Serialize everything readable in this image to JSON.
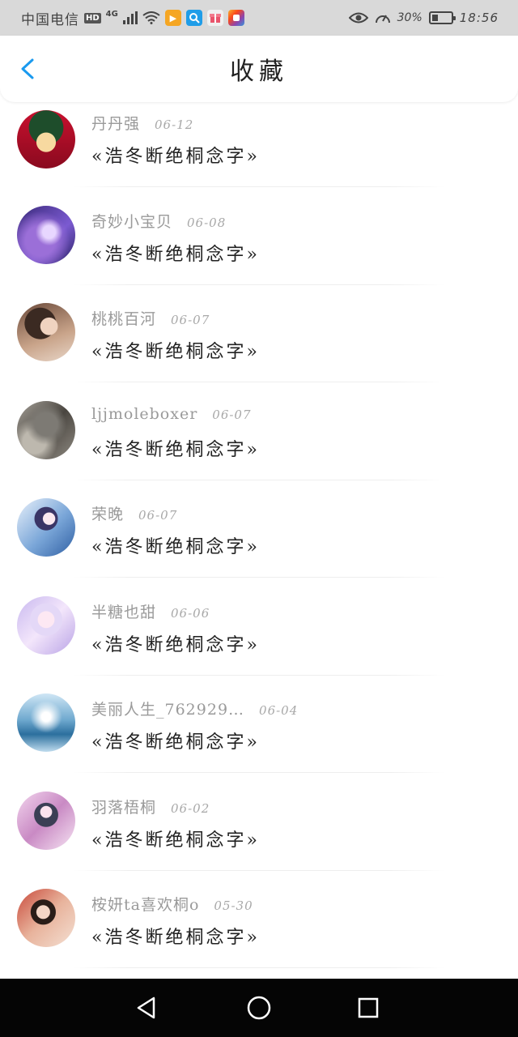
{
  "status_bar": {
    "carrier": "中国电信",
    "hd": "HD",
    "network": "4G",
    "battery": "30%",
    "battery_level": 0.3,
    "time": "18:56"
  },
  "header": {
    "title": "收藏"
  },
  "colors": {
    "accent": "#1a9aef",
    "author_text": "#9a9a9a",
    "work_text": "#222222",
    "nav_bar": "#050505"
  },
  "favorites": [
    {
      "author": "丹丹强",
      "date": "06-12",
      "work": "«浩冬断绝桐念字»"
    },
    {
      "author": "奇妙小宝贝",
      "date": "06-08",
      "work": "«浩冬断绝桐念字»"
    },
    {
      "author": "桃桃百河",
      "date": "06-07",
      "work": "«浩冬断绝桐念字»"
    },
    {
      "author": "ljjmoleboxer",
      "date": "06-07",
      "work": "«浩冬断绝桐念字»"
    },
    {
      "author": "荣晚",
      "date": "06-07",
      "work": "«浩冬断绝桐念字»"
    },
    {
      "author": "半糖也甜",
      "date": "06-06",
      "work": "«浩冬断绝桐念字»"
    },
    {
      "author": "美丽人生_762929…",
      "date": "06-04",
      "work": "«浩冬断绝桐念字»"
    },
    {
      "author": "羽落梧桐",
      "date": "06-02",
      "work": "«浩冬断绝桐念字»"
    },
    {
      "author": "桉妍ta喜欢桐o",
      "date": "05-30",
      "work": "«浩冬断绝桐念字»"
    }
  ]
}
